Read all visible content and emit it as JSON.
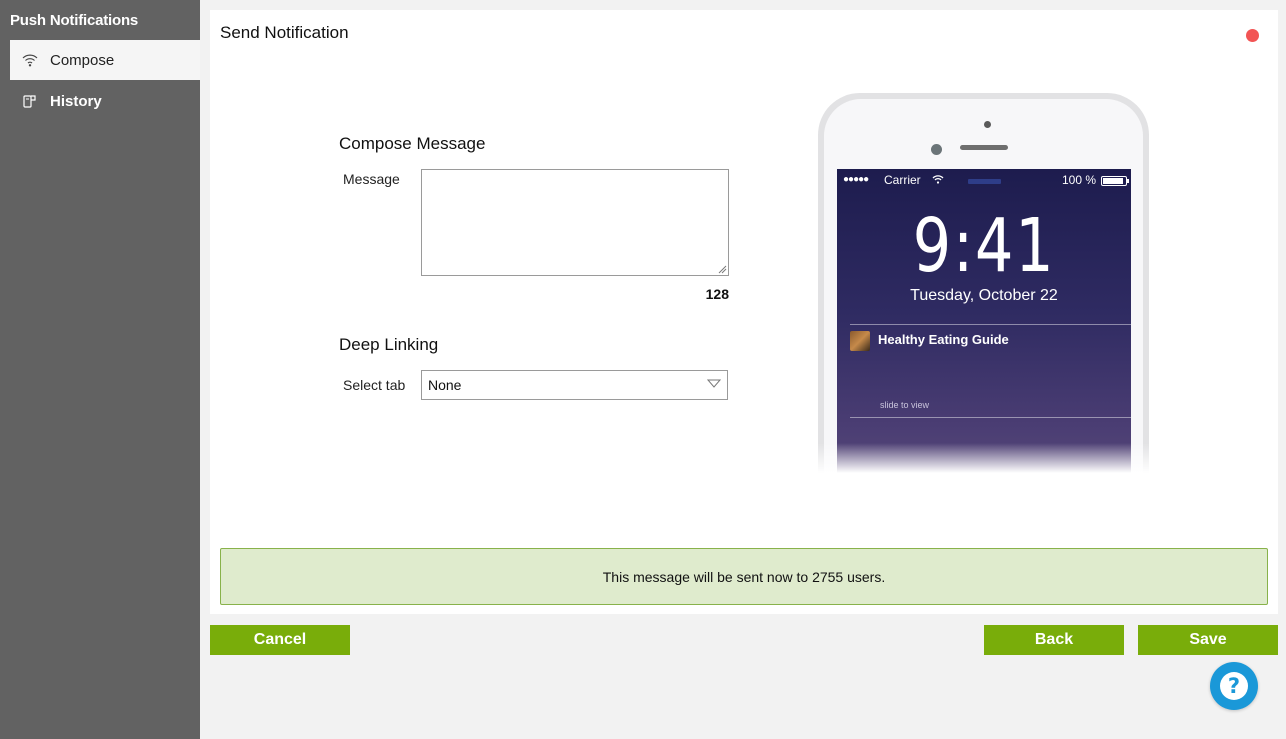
{
  "sidebar": {
    "title": "Push Notifications",
    "items": [
      {
        "label": "Compose",
        "icon": "wifi-signal-icon",
        "active": true
      },
      {
        "label": "History",
        "icon": "history-icon",
        "active": false
      }
    ]
  },
  "panel": {
    "title": "Send Notification",
    "compose": {
      "heading": "Compose Message",
      "message_label": "Message",
      "message_value": "",
      "char_count": "128"
    },
    "deep_linking": {
      "heading": "Deep Linking",
      "select_label": "Select tab",
      "selected": "None"
    },
    "preview": {
      "carrier": "Carrier",
      "signal_dots": "●●●●●",
      "battery": "100 %",
      "time": "9:41",
      "date": "Tuesday, October 22",
      "app_name": "Healthy Eating Guide",
      "slide_hint": "slide to view"
    },
    "info_message": "This message will be sent now to 2755 users."
  },
  "buttons": {
    "cancel": "Cancel",
    "back": "Back",
    "save": "Save",
    "help": "?"
  },
  "colors": {
    "sidebar_bg": "#626262",
    "accent_green": "#79ad0a",
    "info_bg": "#dfebcd",
    "info_border": "#88b24a",
    "close_dot": "#f25454",
    "help_blue": "#1a98d8"
  }
}
